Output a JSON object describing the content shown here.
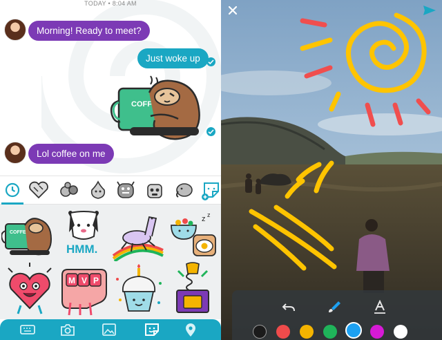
{
  "chat": {
    "timestamp": "TODAY • 8:04 AM",
    "messages": [
      {
        "from": "them",
        "text": "Morning! Ready to meet?"
      },
      {
        "from": "me",
        "text": "Just woke up"
      },
      {
        "from": "me",
        "sticker": "coffee-sloth-sticker",
        "sticker_text": "COFFEE"
      },
      {
        "from": "them",
        "text": "Lol coffee on me"
      }
    ]
  },
  "sticker_tabs": [
    {
      "name": "recent-tab",
      "icon": "clock-icon",
      "selected": true
    },
    {
      "name": "hearts-pack-tab",
      "icon": "heart-sticker-icon"
    },
    {
      "name": "animals-pack-tab",
      "icon": "animals-sticker-icon"
    },
    {
      "name": "onion-pack-tab",
      "icon": "onion-sticker-icon"
    },
    {
      "name": "monster-pack-tab",
      "icon": "monster-sticker-icon"
    },
    {
      "name": "robot-pack-tab",
      "icon": "robot-sticker-icon"
    },
    {
      "name": "elephant-pack-tab",
      "icon": "elephant-sticker-icon"
    },
    {
      "name": "add-sticker-tab",
      "icon": "add-sticker-icon"
    }
  ],
  "stickers": [
    {
      "name": "coffee-sloth-sticker",
      "text": "COFFEE"
    },
    {
      "name": "hmm-dog-sticker",
      "text": "HMM."
    },
    {
      "name": "llama-rainbow-sticker",
      "text": ""
    },
    {
      "name": "breakfast-sticker",
      "text": ""
    },
    {
      "name": "heart-character-sticker",
      "text": ""
    },
    {
      "name": "mvp-fist-sticker",
      "text": "MVP"
    },
    {
      "name": "cupcake-sticker",
      "text": ""
    },
    {
      "name": "jack-in-box-sticker",
      "text": ""
    }
  ],
  "bottom_nav": [
    {
      "name": "keyboard-button",
      "icon": "keyboard-icon"
    },
    {
      "name": "camera-button",
      "icon": "camera-icon"
    },
    {
      "name": "gallery-button",
      "icon": "image-icon"
    },
    {
      "name": "sticker-button",
      "icon": "sticker-icon",
      "active": true
    },
    {
      "name": "location-button",
      "icon": "location-pin-icon"
    }
  ],
  "editor": {
    "close_icon": "close-icon",
    "send_icon": "send-icon",
    "tools": [
      {
        "name": "undo-tool",
        "icon": "undo-icon"
      },
      {
        "name": "brush-tool",
        "icon": "brush-icon"
      },
      {
        "name": "text-tool",
        "icon": "text-icon"
      }
    ],
    "colors": [
      "#1b1b1b",
      "#ef4b4b",
      "#f4b400",
      "#1fb45a",
      "#1da1f2",
      "#d61ad6",
      "#ffffff"
    ],
    "selected_color": "#1da1f2",
    "drawing_colors": {
      "sun": "#ffc400",
      "rays_red": "#f04e4e"
    }
  },
  "colors": {
    "accent": "#1aa7c3",
    "incoming": "#7c3ab5"
  }
}
